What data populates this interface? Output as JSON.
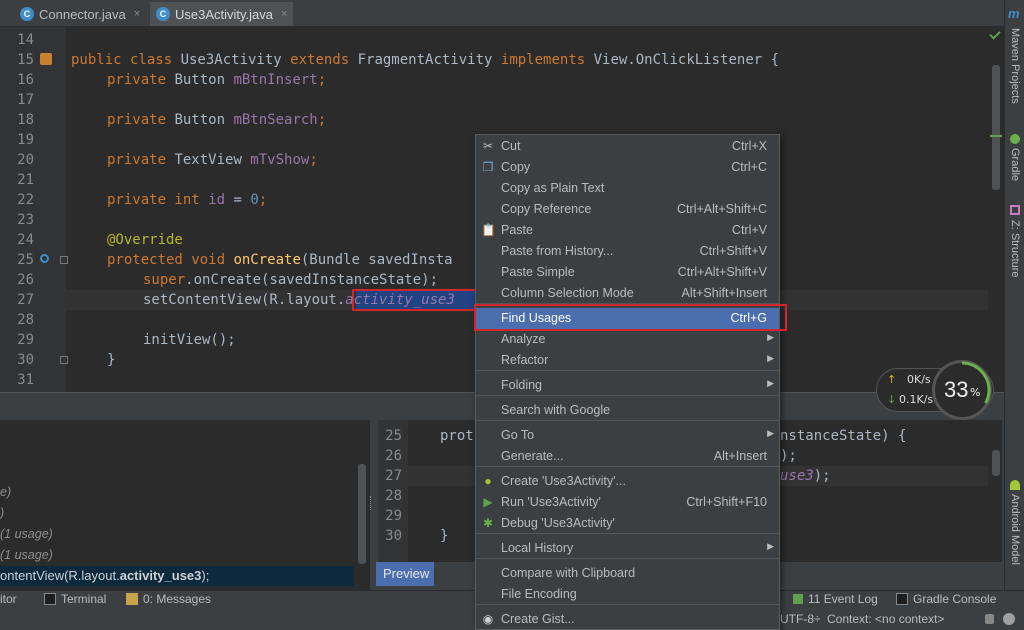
{
  "tabs": [
    {
      "label": "Connector.java",
      "icon": "C",
      "active": false
    },
    {
      "label": "Use3Activity.java",
      "icon": "C",
      "active": true
    }
  ],
  "close_glyph": "×",
  "right_tools": {
    "maven_glyph": "m",
    "maven": "Maven Projects",
    "gradle": "Gradle",
    "structure": "Z: Structure",
    "android_model": "Android Model"
  },
  "editor": {
    "lines": [
      {
        "n": "14"
      },
      {
        "n": "15"
      },
      {
        "n": "16"
      },
      {
        "n": "17"
      },
      {
        "n": "18"
      },
      {
        "n": "19"
      },
      {
        "n": "20"
      },
      {
        "n": "21"
      },
      {
        "n": "22"
      },
      {
        "n": "23"
      },
      {
        "n": "24"
      },
      {
        "n": "25"
      },
      {
        "n": "26"
      },
      {
        "n": "27"
      },
      {
        "n": "28"
      },
      {
        "n": "29"
      },
      {
        "n": "30"
      },
      {
        "n": "31"
      }
    ],
    "l15": {
      "kw1": "public class ",
      "cls": "Use3Activity ",
      "kw2": "extends ",
      "base": "FragmentActivity ",
      "kw3": "implements ",
      "iface": "View.OnClickListener {"
    },
    "l16": {
      "kw": "private ",
      "type": "Button ",
      "field": "mBtnInsert",
      "end": ";"
    },
    "l18": {
      "kw": "private ",
      "type": "Button ",
      "field": "mBtnSearch",
      "end": ";"
    },
    "l20": {
      "kw": "private ",
      "type": "TextView ",
      "field": "mTvShow",
      "end": ";"
    },
    "l22": {
      "kw": "private int ",
      "field": "id",
      "eq": " = ",
      "num": "0",
      "end": ";"
    },
    "l24": {
      "ann": "@Override"
    },
    "l25": {
      "kw": "protected void ",
      "fn": "onCreate",
      "rest": "(Bundle savedInsta"
    },
    "l26": {
      "kw": "super",
      "rest": ".onCreate(savedInstanceState);"
    },
    "l27": {
      "pre": "setContentView(R.layout.",
      "it": "activity_use3"
    },
    "l29": {
      "text": "initView();"
    },
    "l30": {
      "text": "}"
    }
  },
  "find_usages_panel": {
    "items": [
      {
        "text": "e)"
      },
      {
        "text": ")"
      },
      {
        "text": "(1 usage)"
      },
      {
        "text": "(1 usage)"
      }
    ],
    "selected_pre": "ontentView(R.layout.",
    "selected_bold": "activity_use3",
    "selected_post": ");"
  },
  "preview": {
    "lines": [
      {
        "n": "25"
      },
      {
        "n": "26"
      },
      {
        "n": "27"
      },
      {
        "n": "28"
      },
      {
        "n": "29"
      },
      {
        "n": "30"
      }
    ],
    "l25_kw": "prot",
    "l25_rest": "nstanceState) {",
    "l26_rest": ");",
    "l27_it": "use3",
    "l27_rest": ");",
    "l30": "}",
    "tab_label": "Preview"
  },
  "status_tools": {
    "itor": "itor",
    "terminal": "Terminal",
    "messages": "0: Messages",
    "event_log": "11 Event Log",
    "gradle_console": "Gradle Console"
  },
  "infobar": {
    "encoding": "UTF-8÷",
    "context": "Context: <no context>"
  },
  "network": {
    "up": "0K/s",
    "down": "0.1K/s",
    "up_arrow": "↑",
    "down_arrow": "↓",
    "percent_num": "33",
    "percent_sign": "%",
    "percent_value": 33
  },
  "context_menu": {
    "items": [
      {
        "label": "Cut",
        "shortcut": "Ctrl+X",
        "icon": "cut-icon",
        "glyph": "✂"
      },
      {
        "label": "Copy",
        "shortcut": "Ctrl+C",
        "icon": "copy-icon",
        "glyph": "❐"
      },
      {
        "label": "Copy as Plain Text",
        "shortcut": ""
      },
      {
        "label": "Copy Reference",
        "shortcut": "Ctrl+Alt+Shift+C"
      },
      {
        "label": "Paste",
        "shortcut": "Ctrl+V",
        "icon": "paste-icon",
        "glyph": "📋"
      },
      {
        "label": "Paste from History...",
        "shortcut": "Ctrl+Shift+V"
      },
      {
        "label": "Paste Simple",
        "shortcut": "Ctrl+Alt+Shift+V"
      },
      {
        "label": "Column Selection Mode",
        "shortcut": "Alt+Shift+Insert"
      },
      {
        "label": "Find Usages",
        "shortcut": "Ctrl+G",
        "selected": true
      },
      {
        "label": "Analyze",
        "submenu": true
      },
      {
        "label": "Refactor",
        "submenu": true
      },
      {
        "label": "Folding",
        "submenu": true
      },
      {
        "label": "Search with Google",
        "shortcut": ""
      },
      {
        "label": "Go To",
        "submenu": true
      },
      {
        "label": "Generate...",
        "shortcut": "Alt+Insert"
      },
      {
        "label": "Create 'Use3Activity'...",
        "icon": "android-icon",
        "glyph": "●"
      },
      {
        "label": "Run 'Use3Activity'",
        "shortcut": "Ctrl+Shift+F10",
        "icon": "run-icon",
        "glyph": "▶"
      },
      {
        "label": "Debug 'Use3Activity'",
        "icon": "debug-icon",
        "glyph": "✱"
      },
      {
        "label": "Local History",
        "submenu": true
      },
      {
        "label": "Compare with Clipboard",
        "shortcut": ""
      },
      {
        "label": "File Encoding",
        "shortcut": ""
      },
      {
        "label": "Create Gist...",
        "icon": "github-icon",
        "glyph": "◉"
      }
    ],
    "arrow_glyph": "▶"
  },
  "colors": {
    "selection": "#4b6eaf",
    "highlight_box": "#d2262c",
    "keyword": "#cc7832",
    "field": "#9876aa",
    "method": "#ffc66d"
  }
}
